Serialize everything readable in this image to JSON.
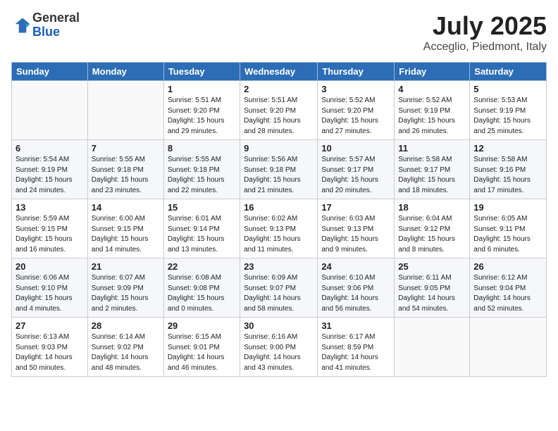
{
  "logo": {
    "general": "General",
    "blue": "Blue"
  },
  "title": {
    "month": "July 2025",
    "location": "Acceglio, Piedmont, Italy"
  },
  "headers": [
    "Sunday",
    "Monday",
    "Tuesday",
    "Wednesday",
    "Thursday",
    "Friday",
    "Saturday"
  ],
  "weeks": [
    [
      {
        "day": "",
        "info": ""
      },
      {
        "day": "",
        "info": ""
      },
      {
        "day": "1",
        "info": "Sunrise: 5:51 AM\nSunset: 9:20 PM\nDaylight: 15 hours\nand 29 minutes."
      },
      {
        "day": "2",
        "info": "Sunrise: 5:51 AM\nSunset: 9:20 PM\nDaylight: 15 hours\nand 28 minutes."
      },
      {
        "day": "3",
        "info": "Sunrise: 5:52 AM\nSunset: 9:20 PM\nDaylight: 15 hours\nand 27 minutes."
      },
      {
        "day": "4",
        "info": "Sunrise: 5:52 AM\nSunset: 9:19 PM\nDaylight: 15 hours\nand 26 minutes."
      },
      {
        "day": "5",
        "info": "Sunrise: 5:53 AM\nSunset: 9:19 PM\nDaylight: 15 hours\nand 25 minutes."
      }
    ],
    [
      {
        "day": "6",
        "info": "Sunrise: 5:54 AM\nSunset: 9:19 PM\nDaylight: 15 hours\nand 24 minutes."
      },
      {
        "day": "7",
        "info": "Sunrise: 5:55 AM\nSunset: 9:18 PM\nDaylight: 15 hours\nand 23 minutes."
      },
      {
        "day": "8",
        "info": "Sunrise: 5:55 AM\nSunset: 9:18 PM\nDaylight: 15 hours\nand 22 minutes."
      },
      {
        "day": "9",
        "info": "Sunrise: 5:56 AM\nSunset: 9:18 PM\nDaylight: 15 hours\nand 21 minutes."
      },
      {
        "day": "10",
        "info": "Sunrise: 5:57 AM\nSunset: 9:17 PM\nDaylight: 15 hours\nand 20 minutes."
      },
      {
        "day": "11",
        "info": "Sunrise: 5:58 AM\nSunset: 9:17 PM\nDaylight: 15 hours\nand 18 minutes."
      },
      {
        "day": "12",
        "info": "Sunrise: 5:58 AM\nSunset: 9:16 PM\nDaylight: 15 hours\nand 17 minutes."
      }
    ],
    [
      {
        "day": "13",
        "info": "Sunrise: 5:59 AM\nSunset: 9:15 PM\nDaylight: 15 hours\nand 16 minutes."
      },
      {
        "day": "14",
        "info": "Sunrise: 6:00 AM\nSunset: 9:15 PM\nDaylight: 15 hours\nand 14 minutes."
      },
      {
        "day": "15",
        "info": "Sunrise: 6:01 AM\nSunset: 9:14 PM\nDaylight: 15 hours\nand 13 minutes."
      },
      {
        "day": "16",
        "info": "Sunrise: 6:02 AM\nSunset: 9:13 PM\nDaylight: 15 hours\nand 11 minutes."
      },
      {
        "day": "17",
        "info": "Sunrise: 6:03 AM\nSunset: 9:13 PM\nDaylight: 15 hours\nand 9 minutes."
      },
      {
        "day": "18",
        "info": "Sunrise: 6:04 AM\nSunset: 9:12 PM\nDaylight: 15 hours\nand 8 minutes."
      },
      {
        "day": "19",
        "info": "Sunrise: 6:05 AM\nSunset: 9:11 PM\nDaylight: 15 hours\nand 6 minutes."
      }
    ],
    [
      {
        "day": "20",
        "info": "Sunrise: 6:06 AM\nSunset: 9:10 PM\nDaylight: 15 hours\nand 4 minutes."
      },
      {
        "day": "21",
        "info": "Sunrise: 6:07 AM\nSunset: 9:09 PM\nDaylight: 15 hours\nand 2 minutes."
      },
      {
        "day": "22",
        "info": "Sunrise: 6:08 AM\nSunset: 9:08 PM\nDaylight: 15 hours\nand 0 minutes."
      },
      {
        "day": "23",
        "info": "Sunrise: 6:09 AM\nSunset: 9:07 PM\nDaylight: 14 hours\nand 58 minutes."
      },
      {
        "day": "24",
        "info": "Sunrise: 6:10 AM\nSunset: 9:06 PM\nDaylight: 14 hours\nand 56 minutes."
      },
      {
        "day": "25",
        "info": "Sunrise: 6:11 AM\nSunset: 9:05 PM\nDaylight: 14 hours\nand 54 minutes."
      },
      {
        "day": "26",
        "info": "Sunrise: 6:12 AM\nSunset: 9:04 PM\nDaylight: 14 hours\nand 52 minutes."
      }
    ],
    [
      {
        "day": "27",
        "info": "Sunrise: 6:13 AM\nSunset: 9:03 PM\nDaylight: 14 hours\nand 50 minutes."
      },
      {
        "day": "28",
        "info": "Sunrise: 6:14 AM\nSunset: 9:02 PM\nDaylight: 14 hours\nand 48 minutes."
      },
      {
        "day": "29",
        "info": "Sunrise: 6:15 AM\nSunset: 9:01 PM\nDaylight: 14 hours\nand 46 minutes."
      },
      {
        "day": "30",
        "info": "Sunrise: 6:16 AM\nSunset: 9:00 PM\nDaylight: 14 hours\nand 43 minutes."
      },
      {
        "day": "31",
        "info": "Sunrise: 6:17 AM\nSunset: 8:59 PM\nDaylight: 14 hours\nand 41 minutes."
      },
      {
        "day": "",
        "info": ""
      },
      {
        "day": "",
        "info": ""
      }
    ]
  ]
}
